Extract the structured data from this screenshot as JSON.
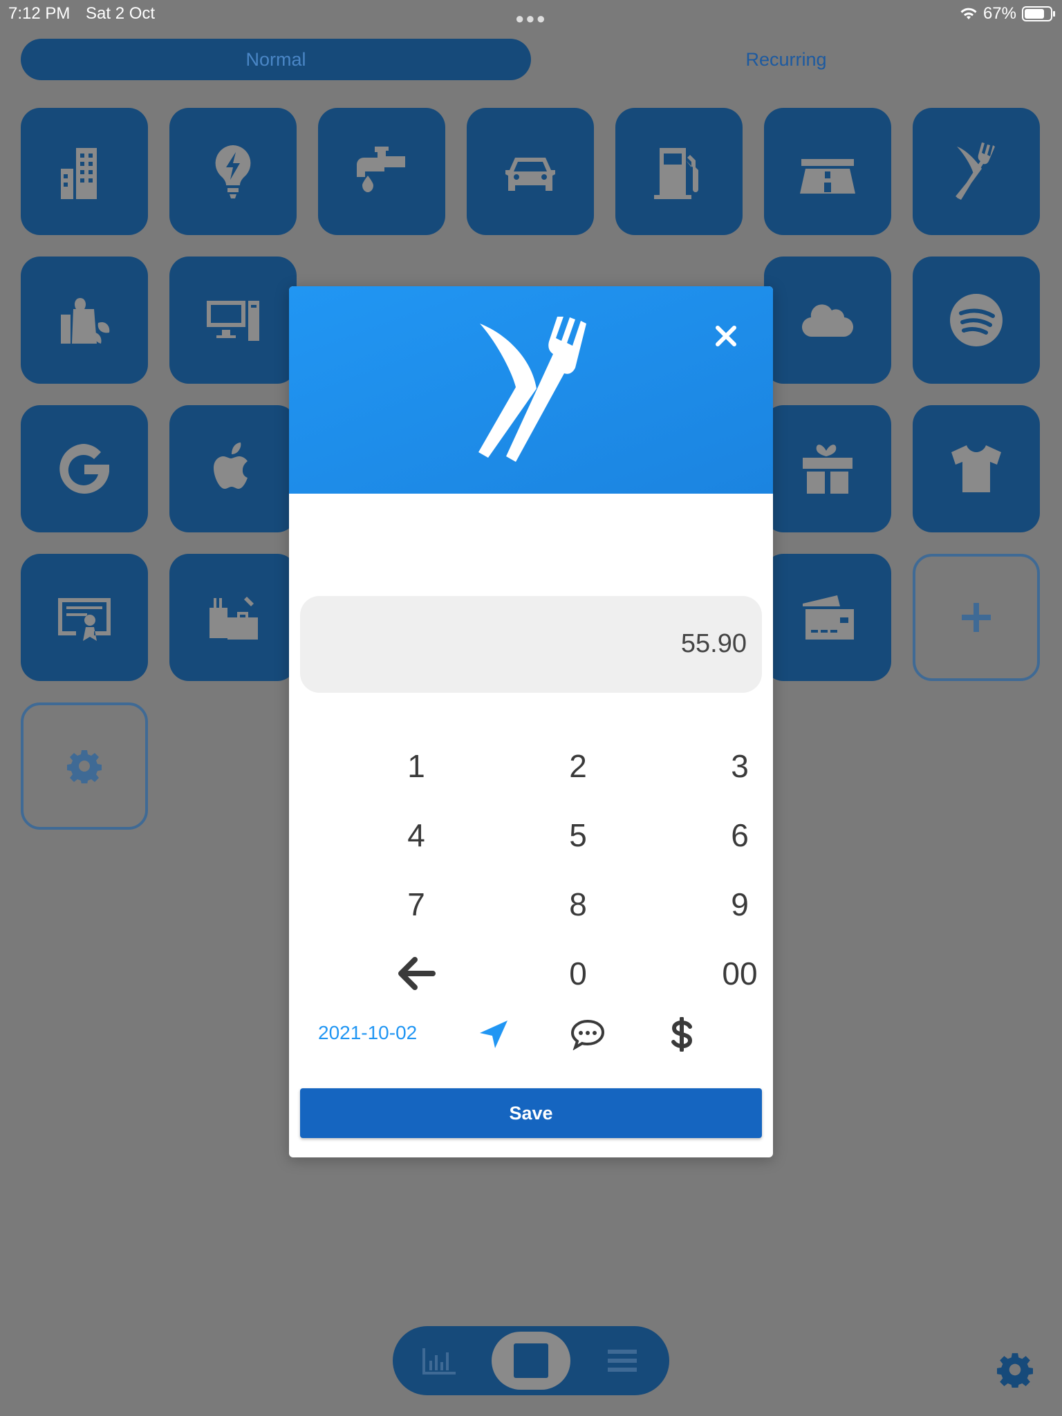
{
  "status_bar": {
    "time": "7:12 PM",
    "date": "Sat 2 Oct",
    "battery": "67%",
    "battery_level": 0.67
  },
  "tabs": {
    "normal": "Normal",
    "recurring": "Recurring",
    "selected": "Normal"
  },
  "categories": [
    {
      "icon": "building-icon"
    },
    {
      "icon": "lightbulb-icon"
    },
    {
      "icon": "faucet-icon"
    },
    {
      "icon": "car-icon"
    },
    {
      "icon": "gas-pump-icon"
    },
    {
      "icon": "highway-icon"
    },
    {
      "icon": "utensils-icon"
    },
    {
      "icon": "groceries-icon"
    },
    {
      "icon": "computer-icon"
    },
    {
      "icon": "cloud-icon"
    },
    {
      "icon": "spotify-icon"
    },
    {
      "icon": "google-icon"
    },
    {
      "icon": "apple-icon"
    },
    {
      "icon": "gift-icon"
    },
    {
      "icon": "tshirt-icon"
    },
    {
      "icon": "certificate-icon"
    },
    {
      "icon": "luggage-icon"
    },
    {
      "icon": "credit-card-icon"
    },
    {
      "icon": "plus-icon"
    },
    {
      "icon": "gear-icon"
    }
  ],
  "dialog": {
    "category_icon": "utensils-icon",
    "close_icon": "close-icon",
    "amount": "55.90",
    "keys": [
      "1",
      "2",
      "3",
      "4",
      "5",
      "6",
      "7",
      "8",
      "9",
      "",
      "0",
      "00"
    ],
    "date": "2021-10-02",
    "save_label": "Save"
  },
  "bottom_nav": {
    "items": [
      "chart-icon",
      "square-icon",
      "list-icon"
    ],
    "active": "square-icon"
  },
  "colors": {
    "accent": "#2196f3",
    "tile": "#164a7a",
    "save": "#1565c0",
    "overlay": "#7a7a7a"
  }
}
